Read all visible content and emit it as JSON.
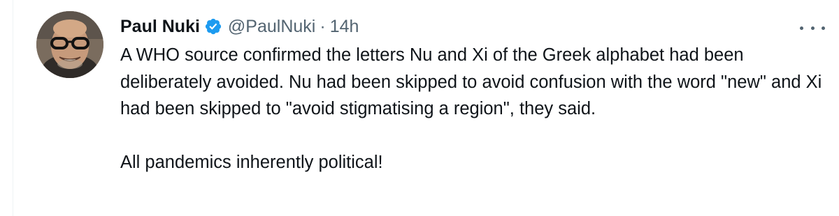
{
  "tweet": {
    "author_name": "Paul Nuki",
    "verified": true,
    "handle": "@PaulNuki",
    "separator": "·",
    "time": "14h",
    "paragraphs": [
      "A WHO source confirmed the letters Nu and Xi of the Greek alphabet had been deliberately avoided. Nu had been skipped to avoid confusion with the word \"new\" and Xi had been skipped to \"avoid stigmatising a region\", they said.",
      "All pandemics inherently political!"
    ]
  },
  "icons": {
    "verified": "verified-badge-icon",
    "more": "more-options-icon"
  },
  "colors": {
    "text": "#0f1419",
    "secondary": "#536471",
    "verified": "#1d9bf0",
    "border": "#eff3f4"
  }
}
